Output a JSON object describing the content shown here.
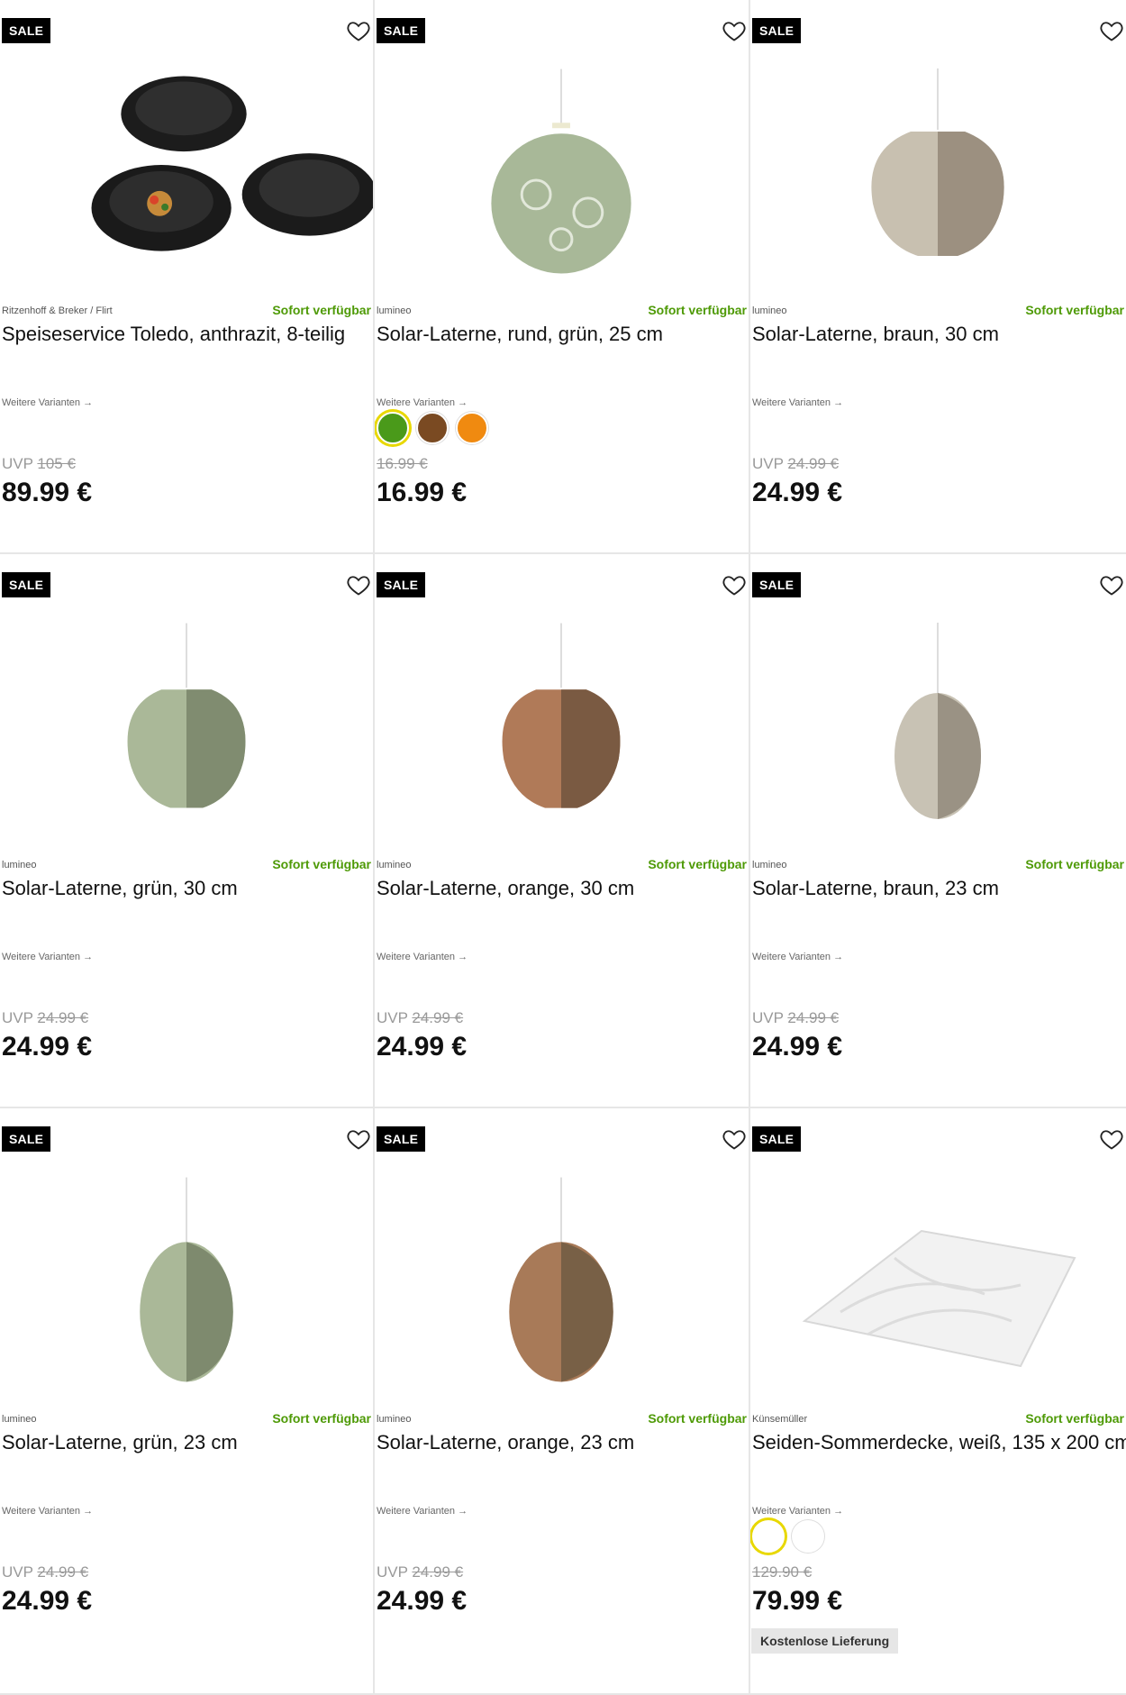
{
  "products": [
    {
      "badge": "SALE",
      "brand": "Ritzenhoff & Breker / Flirt",
      "availability": "Sofort verfügbar",
      "title": "Speiseservice Toledo, anthrazit, 8-teilig",
      "variants_link": "Weitere Varianten →",
      "old_price_prefix": "UVP",
      "old_price": "105 €",
      "price": "89.99 €",
      "image_icon": "plates-image"
    },
    {
      "badge": "SALE",
      "brand": "lumineo",
      "availability": "Sofort verfügbar",
      "title": "Solar-Laterne, rund, grün, 25 cm",
      "variants_link": "Weitere Varianten →",
      "old_price_prefix": "",
      "old_price": "16.99 €",
      "price": "16.99 €",
      "image_icon": "lantern-image",
      "swatches": [
        "#4a9a1a",
        "#7a4a22",
        "#f08a10"
      ]
    },
    {
      "badge": "SALE",
      "brand": "lumineo",
      "availability": "Sofort verfügbar",
      "title": "Solar-Laterne, braun, 30 cm",
      "variants_link": "Weitere Varianten →",
      "old_price_prefix": "UVP",
      "old_price": "24.99 €",
      "price": "24.99 €",
      "image_icon": "lantern-image"
    },
    {
      "badge": "SALE",
      "brand": "lumineo",
      "availability": "Sofort verfügbar",
      "title": "Solar-Laterne, grün, 30 cm",
      "variants_link": "Weitere Varianten →",
      "old_price_prefix": "UVP",
      "old_price": "24.99 €",
      "price": "24.99 €",
      "image_icon": "lantern-image"
    },
    {
      "badge": "SALE",
      "brand": "lumineo",
      "availability": "Sofort verfügbar",
      "title": "Solar-Laterne, orange, 30 cm",
      "variants_link": "Weitere Varianten →",
      "old_price_prefix": "UVP",
      "old_price": "24.99 €",
      "price": "24.99 €",
      "image_icon": "lantern-image"
    },
    {
      "badge": "SALE",
      "brand": "lumineo",
      "availability": "Sofort verfügbar",
      "title": "Solar-Laterne, braun, 23 cm",
      "variants_link": "Weitere Varianten →",
      "old_price_prefix": "UVP",
      "old_price": "24.99 €",
      "price": "24.99 €",
      "image_icon": "lantern-image"
    },
    {
      "badge": "SALE",
      "brand": "lumineo",
      "availability": "Sofort verfügbar",
      "title": "Solar-Laterne, grün, 23 cm",
      "variants_link": "Weitere Varianten →",
      "old_price_prefix": "UVP",
      "old_price": "24.99 €",
      "price": "24.99 €",
      "image_icon": "lantern-image"
    },
    {
      "badge": "SALE",
      "brand": "lumineo",
      "availability": "Sofort verfügbar",
      "title": "Solar-Laterne, orange, 23 cm",
      "variants_link": "Weitere Varianten →",
      "old_price_prefix": "UVP",
      "old_price": "24.99 €",
      "price": "24.99 €",
      "image_icon": "lantern-image"
    },
    {
      "badge": "SALE",
      "brand": "Künsemüller",
      "availability": "Sofort verfügbar",
      "title": "Seiden-Sommerdecke, weiß, 135 x 200 cm",
      "variants_link": "Weitere Varianten →",
      "old_price_prefix": "",
      "old_price": "129.90 €",
      "price": "79.99 €",
      "image_icon": "blanket-image",
      "swatches": [
        "#ffffff",
        "#ffffff"
      ],
      "delivery_badge": "Kostenlose Lieferung"
    }
  ],
  "colors": {
    "availability": "#4e9a06",
    "sale_badge_bg": "#000000",
    "selected_swatch_ring": "#e8d800"
  }
}
